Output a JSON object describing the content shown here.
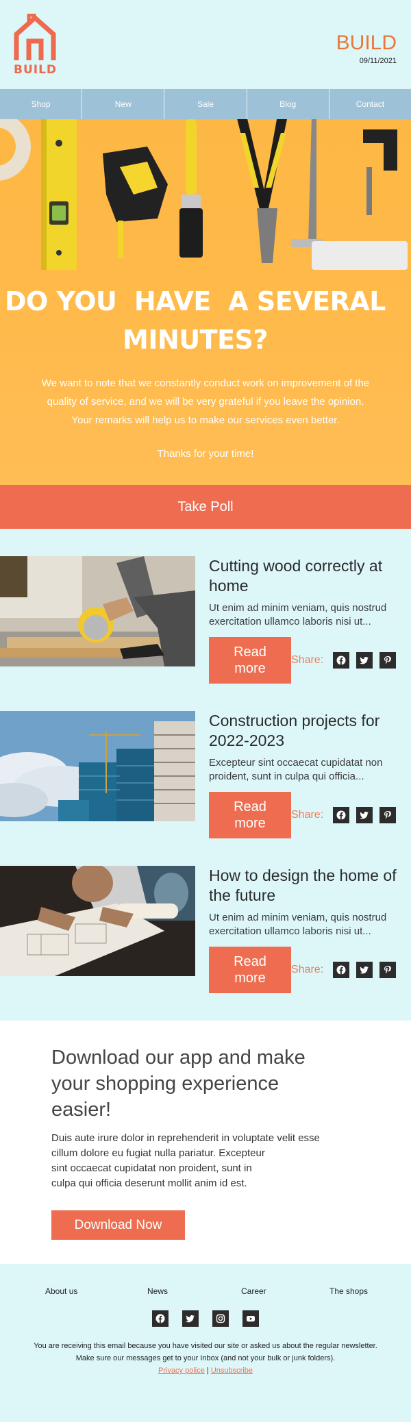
{
  "header": {
    "logo_text": "BUILD",
    "brand": "BUILD",
    "date": "09/11/2021"
  },
  "nav": [
    {
      "label": "Shop"
    },
    {
      "label": "New"
    },
    {
      "label": "Sale"
    },
    {
      "label": "Blog"
    },
    {
      "label": "Contact"
    }
  ],
  "hero": {
    "title_line1": "DO YOU  HAVE  A SEVERAL",
    "title_line2": "MINUTES?",
    "text_line1": "We want to note that we constantly conduct work on improvement of the",
    "text_line2": "quality of service, and we will be very grateful if you leave the opinion.",
    "text_line3": "Your remarks will help us to make our services even better.",
    "thanks": "Thanks for your time!",
    "poll_button": "Take Poll"
  },
  "articles": [
    {
      "title": "Cutting wood correctly at home",
      "desc_line1": "Ut enim ad minim veniam, quis nostrud",
      "desc_line2": "exercitation ullamco laboris nisi ut...",
      "read_line1": "Read",
      "read_line2": "more",
      "share": "Share:"
    },
    {
      "title": "Construction projects for 2022-2023",
      "desc_line1": "Excepteur sint occaecat cupidatat non",
      "desc_line2": "proident, sunt in culpa qui officia...",
      "read_line1": "Read",
      "read_line2": "more",
      "share": "Share:"
    },
    {
      "title": "How to design the home of the future",
      "desc_line1": "Ut enim ad minim veniam, quis nostrud",
      "desc_line2": "exercitation ullamco laboris nisi ut...",
      "read_line1": "Read",
      "read_line2": "more",
      "share": "Share:"
    }
  ],
  "social_icons": [
    "facebook-icon",
    "twitter-icon",
    "pinterest-icon"
  ],
  "app": {
    "title": "Download our app and make your shopping experience easier!",
    "text_line1": "Duis aute irure dolor in reprehenderit in voluptate velit esse",
    "text_line2": "cillum dolore eu fugiat nulla pariatur. Excepteur",
    "text_line3": "sint occaecat cupidatat non proident, sunt in",
    "text_line4": "culpa qui officia deserunt mollit anim id est.",
    "button": "Download Now"
  },
  "footer": {
    "links": [
      {
        "label": "About us"
      },
      {
        "label": "News"
      },
      {
        "label": "Career"
      },
      {
        "label": "The shops"
      }
    ],
    "social_icons": [
      "facebook-icon",
      "twitter-icon",
      "instagram-icon",
      "youtube-icon"
    ],
    "notice_line1": "You are receiving this email because you have visited our site or asked us about the regular newsletter.",
    "notice_line2": "Make sure our messages get to your Inbox (and not your bulk or junk folders).",
    "privacy": "Privacy police",
    "separator": "|",
    "unsubscribe": "Unsubscribe"
  },
  "colors": {
    "background": "#ddf7f9",
    "accent": "#ee6d50",
    "nav": "#9dc1d6",
    "hero": "#ffb948",
    "brand": "#e8783a"
  }
}
